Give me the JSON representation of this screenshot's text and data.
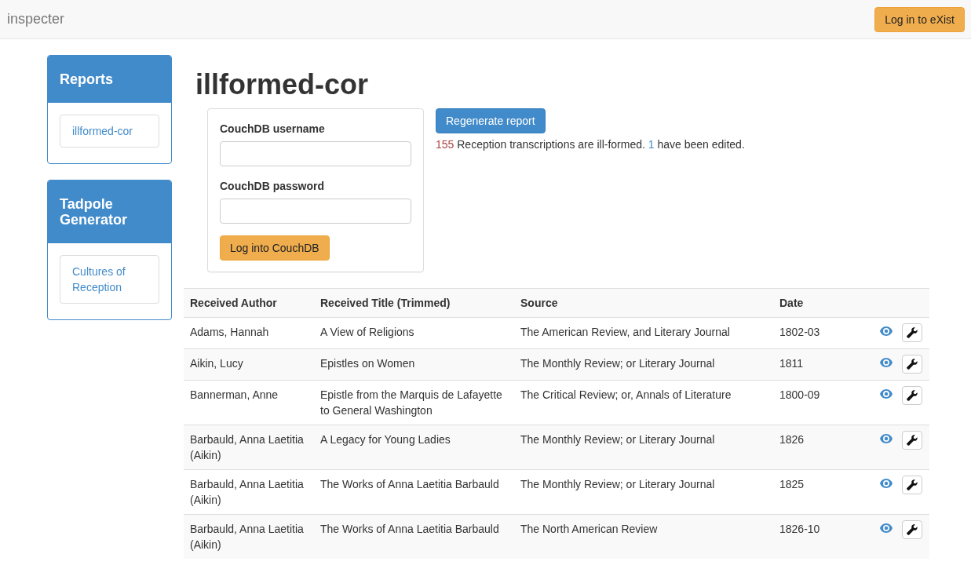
{
  "navbar": {
    "brand": "inspecter",
    "login_button": "Log in to eXist"
  },
  "sidebar": [
    {
      "title": "Reports",
      "links": [
        "illformed-cor"
      ]
    },
    {
      "title": "Tadpole Generator",
      "links": [
        "Cultures of Reception"
      ]
    }
  ],
  "page_title": "illformed-cor",
  "login_form": {
    "username_label": "CouchDB username",
    "password_label": "CouchDB password",
    "button": "Log into CouchDB"
  },
  "regenerate_button": "Regenerate report",
  "summary": [
    {
      "kind": "bad-count",
      "text": "155"
    },
    {
      "kind": "plain",
      "text": " Reception transcriptions are ill-formed. "
    },
    {
      "kind": "edited-count",
      "text": "1"
    },
    {
      "kind": "plain",
      "text": " have been edited."
    }
  ],
  "table": {
    "columns": [
      "Received Author",
      "Received Title (Trimmed)",
      "Source",
      "Date"
    ],
    "rows": [
      {
        "author": "Adams, Hannah",
        "title": "A View of Religions",
        "source": "The American Review, and Literary Journal",
        "date": "1802-03"
      },
      {
        "author": "Aikin, Lucy",
        "title": "Epistles on Women",
        "source": "The Monthly Review; or Literary Journal",
        "date": "1811"
      },
      {
        "author": "Bannerman, Anne",
        "title": "Epistle from the Marquis de Lafayette to General Washington",
        "source": "The Critical Review; or, Annals of Literature",
        "date": "1800-09"
      },
      {
        "author": "Barbauld, Anna Laetitia (Aikin)",
        "title": "A Legacy for Young Ladies",
        "source": "The Monthly Review; or Literary Journal",
        "date": "1826"
      },
      {
        "author": "Barbauld, Anna Laetitia (Aikin)",
        "title": "The Works of Anna Laetitia Barbauld",
        "source": "The Monthly Review; or Literary Journal",
        "date": "1825"
      },
      {
        "author": "Barbauld, Anna Laetitia (Aikin)",
        "title": "The Works of Anna Laetitia Barbauld",
        "source": "The North American Review",
        "date": "1826-10"
      }
    ]
  }
}
